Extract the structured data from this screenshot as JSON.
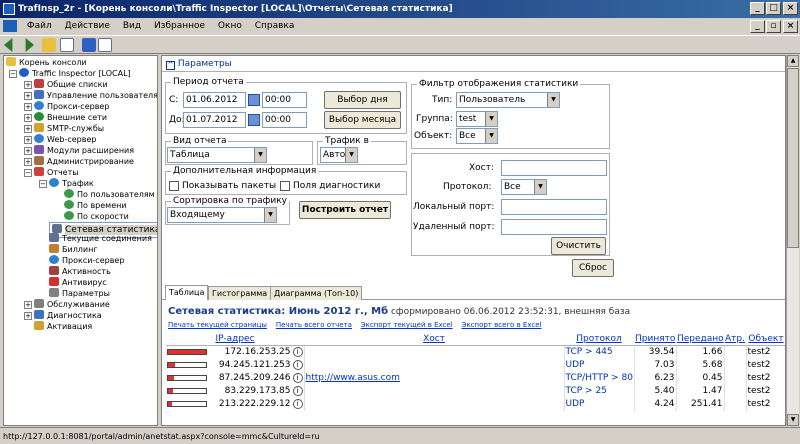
{
  "window": {
    "title": "TrafInsp_2r - [Корень консоли\\Traffic Inspector [LOCAL]\\Отчеты\\Сетевая статистика]",
    "min": "_",
    "max": "□",
    "close": "×",
    "inner_min": "_",
    "inner_max": "▫",
    "inner_close": "×"
  },
  "menu": [
    "Файл",
    "Действие",
    "Вид",
    "Избранное",
    "Окно",
    "Справка"
  ],
  "tree": {
    "root": "Корень консоли",
    "ti": "Traffic Inspector [LOCAL]",
    "items": [
      "Общие списки",
      "Управление пользователями",
      "Прокси-сервер",
      "Внешние сети",
      "SMTP-службы",
      "Web-сервер",
      "Модули расширения",
      "Администрирование",
      "Отчеты",
      "Трафик",
      "По пользователям",
      "По времени",
      "По скорости",
      "Сетевая статистика",
      "Текущие соединения",
      "Биллинг",
      "Прокси-сервер",
      "Активность",
      "Антивирус",
      "Параметры",
      "Обслуживание",
      "Диагностика",
      "Активация"
    ]
  },
  "params_header": "Параметры",
  "period": {
    "legend": "Период отчета",
    "from_label": "С:",
    "from_date": "01.06.2012",
    "from_time": "00:00",
    "to_label": "До:",
    "to_date": "01.07.2012",
    "to_time": "00:00",
    "day_btn": "Выбор дня",
    "month_btn": "Выбор месяца"
  },
  "view": {
    "legend": "Вид отчета",
    "value": "Таблица"
  },
  "traffic": {
    "legend": "Трафик в",
    "value": "Авто"
  },
  "extra": {
    "legend": "Дополнительная информация",
    "show_packets": "Показывать пакеты",
    "diag_fields": "Поля диагностики"
  },
  "sort": {
    "legend": "Сортировка по трафику",
    "value": "Входящему",
    "build_btn": "Построить отчет"
  },
  "filter": {
    "legend": "Фильтр отображения статистики",
    "type_label": "Тип:",
    "type_value": "Пользователь",
    "group_label": "Группа:",
    "group_value": "test",
    "object_label": "Объект:",
    "object_value": "Все",
    "host_label": "Хост:",
    "host_value": "",
    "proto_label": "Протокол:",
    "proto_value": "Все",
    "local_port_label": "Локальный порт:",
    "local_port_value": "",
    "remote_port_label": "Удаленный порт:",
    "remote_port_value": "",
    "clear_btn": "Очистить",
    "reset_btn": "Сброс"
  },
  "tabs": [
    "Таблица",
    "Гистограмма",
    "Диаграмма (Топ-10)"
  ],
  "report": {
    "title": "Сетевая статистика: Июнь 2012 г., Мб",
    "generated": "сформировано 06.06.2012 23:52:31, внешняя база",
    "links": [
      "Печать текущей страницы",
      "Печать всего отчета",
      "Экспорт текущей в Excel",
      "Экспорт всего в Excel"
    ]
  },
  "table": {
    "headers": [
      "IP-адрес",
      "Хост",
      "Протокол",
      "Принято",
      "Передано",
      "Атр.",
      "Объект"
    ],
    "rows": [
      {
        "ip": "172.16.253.25",
        "host": "",
        "proto": "TCP > 445",
        "rx": "39.54",
        "tx": "1.66",
        "attr": "",
        "obj": "test2",
        "level": 1.0
      },
      {
        "ip": "94.245.121.253",
        "host": "",
        "proto": "UDP",
        "rx": "7.03",
        "tx": "5.68",
        "attr": "",
        "obj": "test2",
        "level": 0.18
      },
      {
        "ip": "87.245.209.246",
        "host": "http://www.asus.com",
        "proto": "TCP/HTTP > 80",
        "rx": "6.23",
        "tx": "0.45",
        "attr": "",
        "obj": "test2",
        "level": 0.16
      },
      {
        "ip": "83.229.173.85",
        "host": "",
        "proto": "TCP > 25",
        "rx": "5.40",
        "tx": "1.47",
        "attr": "",
        "obj": "test2",
        "level": 0.14
      },
      {
        "ip": "213.222.229.12",
        "host": "",
        "proto": "UDP",
        "rx": "4.24",
        "tx": "251.41",
        "attr": "",
        "obj": "test2",
        "level": 0.11
      }
    ]
  },
  "status": "http://127.0.0.1:8081/portal/admin/anetstat.aspx?console=mmc&CultureId=ru"
}
